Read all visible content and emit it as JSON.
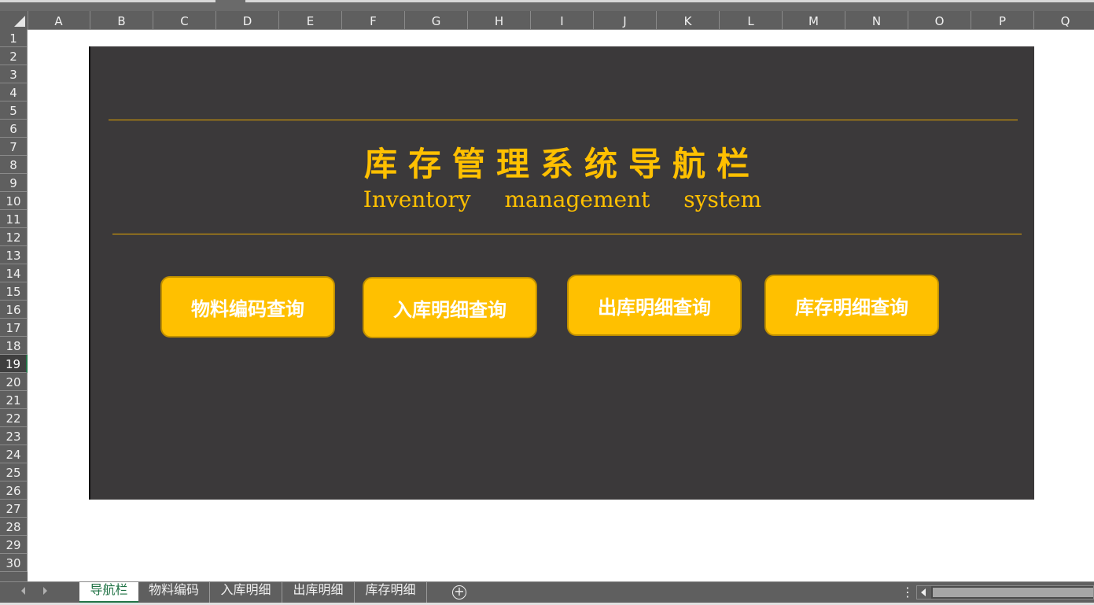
{
  "columns": [
    "A",
    "B",
    "C",
    "D",
    "E",
    "F",
    "G",
    "H",
    "I",
    "J",
    "K",
    "L",
    "M",
    "N",
    "O",
    "P",
    "Q"
  ],
  "rows": [
    "1",
    "2",
    "3",
    "4",
    "5",
    "6",
    "7",
    "8",
    "9",
    "10",
    "11",
    "12",
    "13",
    "14",
    "15",
    "16",
    "17",
    "18",
    "19",
    "20",
    "21",
    "22",
    "23",
    "24",
    "25",
    "26",
    "27",
    "28",
    "29",
    "30"
  ],
  "active_row": "19",
  "dashboard": {
    "title_cn": "库存管理系统导航栏",
    "title_en": "Inventory management system",
    "buttons": [
      "物料编码查询",
      "入库明细查询",
      "出库明细查询",
      "库存明细查询"
    ],
    "colors": {
      "panel_bg": "#3b393a",
      "accent": "#ffc000",
      "button_text": "#ffffff"
    }
  },
  "sheet_tabs": [
    "导航栏",
    "物料编码",
    "入库明细",
    "出库明细",
    "库存明细"
  ],
  "active_tab": "导航栏",
  "icons": {
    "corner": "select-all-icon",
    "add": "add-sheet-icon",
    "more": "more-options-icon"
  }
}
